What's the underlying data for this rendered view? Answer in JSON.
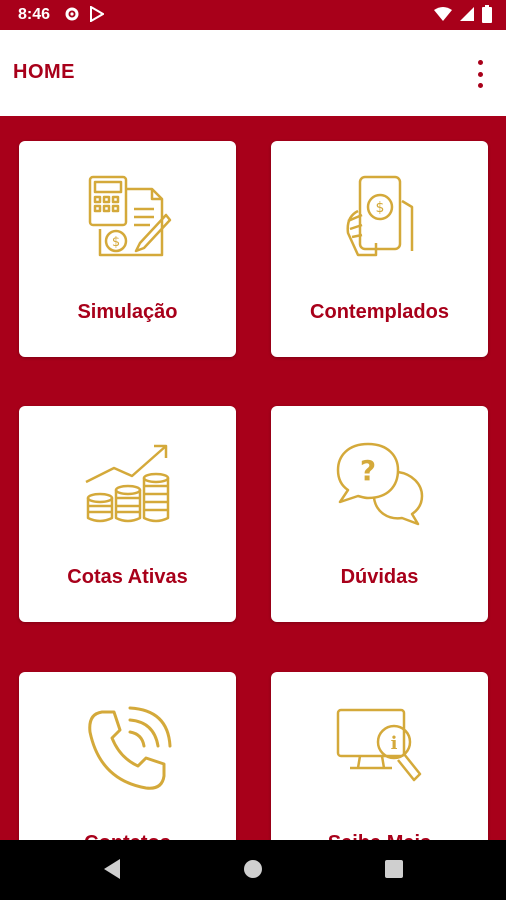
{
  "status": {
    "time": "8:46"
  },
  "app_bar": {
    "title": "HOME"
  },
  "cards": [
    {
      "label": "Simulação",
      "icon": "calculator-document-icon"
    },
    {
      "label": "Contemplados",
      "icon": "phone-money-hand-icon"
    },
    {
      "label": "Cotas Ativas",
      "icon": "coins-growth-icon"
    },
    {
      "label": "Dúvidas",
      "icon": "question-chat-icon"
    },
    {
      "label": "Contatos",
      "icon": "phone-call-icon"
    },
    {
      "label": "Saiba Mais",
      "icon": "info-monitor-icon"
    }
  ],
  "colors": {
    "primary": "#a8001a",
    "gold": "#d4a93a",
    "card": "#ffffff"
  }
}
